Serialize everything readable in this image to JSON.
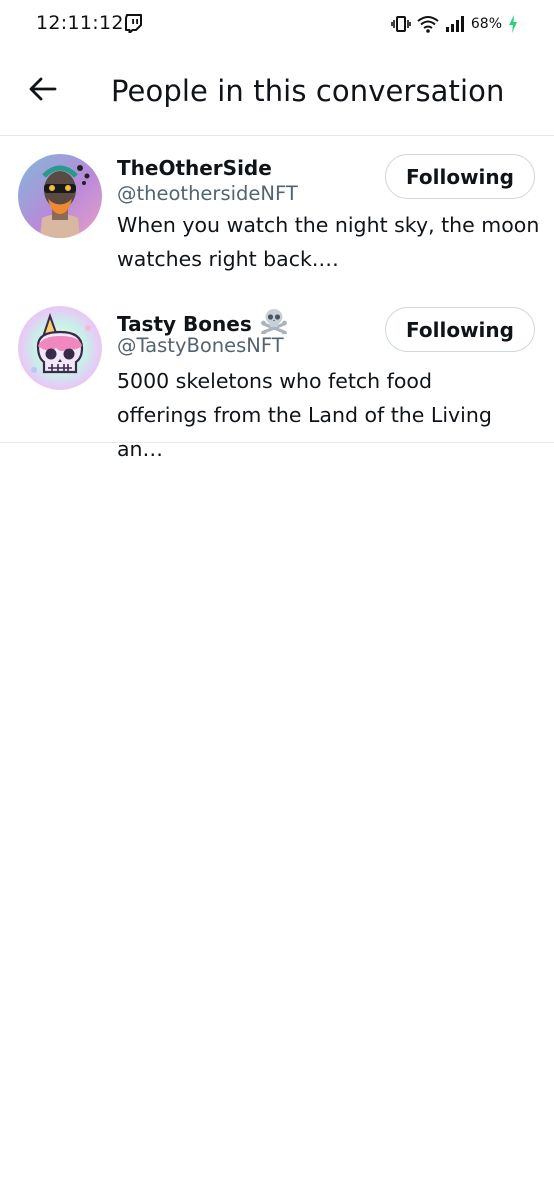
{
  "status_bar": {
    "time": "12:11:12",
    "battery_percent": "68%",
    "icons": [
      "twitch-icon",
      "vibrate-icon",
      "wifi-icon",
      "signal-icon",
      "battery-charging-icon"
    ]
  },
  "header": {
    "title": "People in this conversation",
    "back_icon": "arrow-left-icon"
  },
  "users": [
    {
      "name": "TheOtherSide",
      "handle": "@theothersideNFT",
      "bio_line1": "When you watch the night sky, the moon",
      "bio_line2": "watches right back.…",
      "button_label": "Following"
    },
    {
      "name": "Tasty Bones",
      "name_emoji": "skull-crossbones-icon",
      "handle": "@TastyBonesNFT",
      "bio_line1": "5000 skeletons who fetch food",
      "bio_line2": "offerings from the Land of the Living an…",
      "button_label": "Following"
    }
  ],
  "colors": {
    "text_primary": "#0f1419",
    "text_secondary": "#536471",
    "border": "#cfd9de",
    "divider": "#e6e8ea",
    "charging": "#2bd07c"
  }
}
